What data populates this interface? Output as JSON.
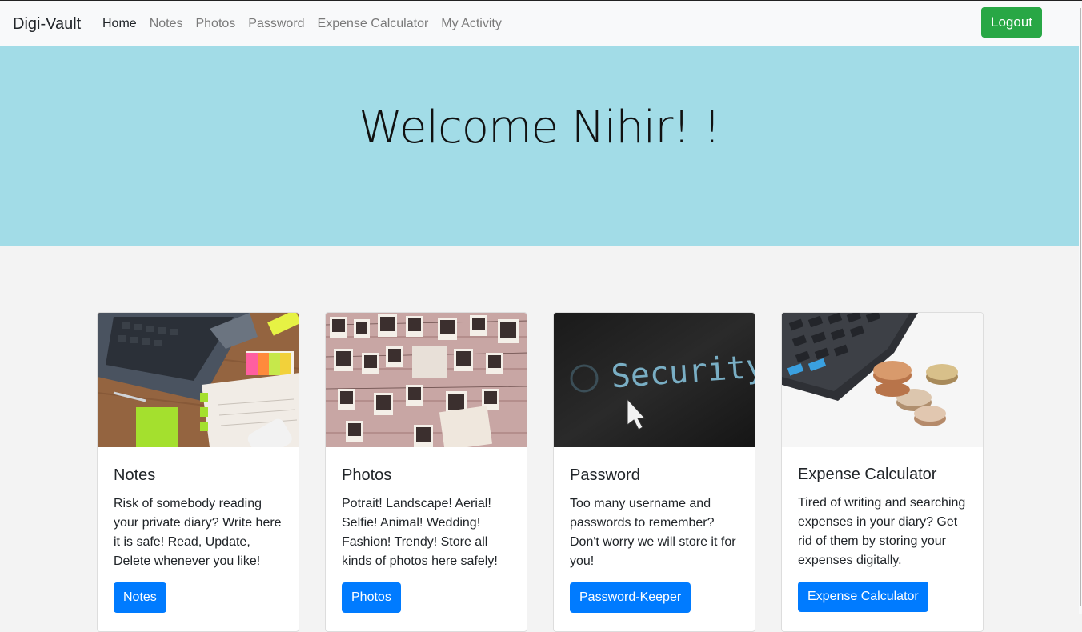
{
  "navbar": {
    "brand": "Digi-Vault",
    "links": [
      "Home",
      "Notes",
      "Photos",
      "Password",
      "Expense Calculator",
      "My Activity"
    ],
    "logout_label": "Logout"
  },
  "hero": {
    "title": "Welcome Nihir! !"
  },
  "cards": [
    {
      "title": "Notes",
      "text": "Risk of somebody reading your private diary? Write here it is safe! Read, Update, Delete whenever you like!",
      "button": "Notes"
    },
    {
      "title": "Photos",
      "text": "Potrait! Landscape! Aerial! Selfie! Animal! Wedding! Fashion! Trendy! Store all kinds of photos here safely!",
      "button": "Photos"
    },
    {
      "title": "Password",
      "text": "Too many username and passwords to remember? Don't worry we will store it for you!",
      "button": "Password-Keeper",
      "image_text": "Security"
    },
    {
      "title": "Expense Calculator",
      "text": "Tired of writing and searching expenses in your diary? Get rid of them by storing your expenses digitally.",
      "button": "Expense Calculator"
    }
  ],
  "colors": {
    "hero": "#a2dce7",
    "primary": "#007bff",
    "success": "#28a745"
  }
}
